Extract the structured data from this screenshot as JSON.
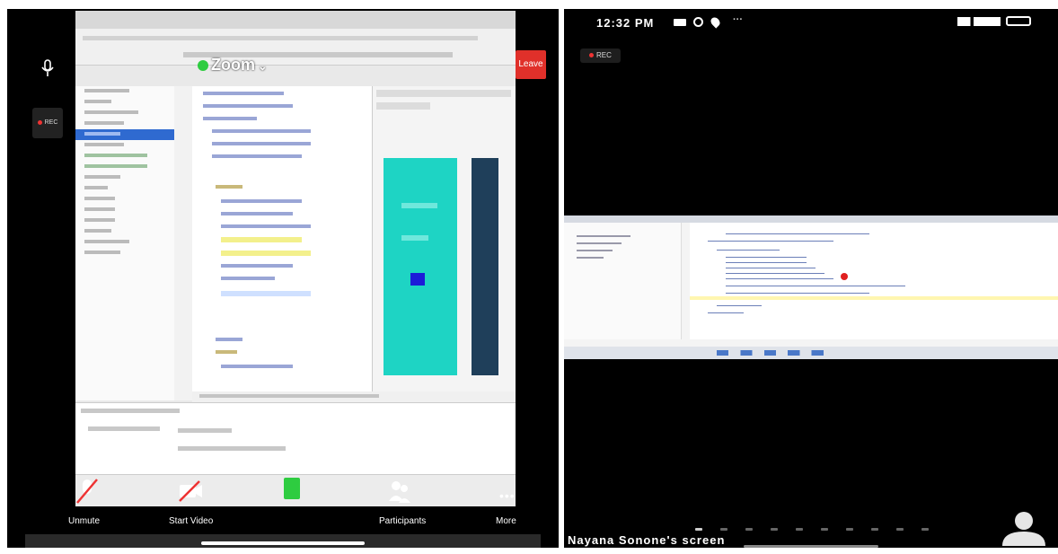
{
  "left": {
    "zoom_label": "Zoom",
    "leave_label": "Leave",
    "rec_label": "REC",
    "toolbar": {
      "unmute_label": "Unmute",
      "start_video_label": "Start Video",
      "participants_label": "Participants",
      "more_label": "More"
    }
  },
  "right": {
    "clock": "12:32 PM",
    "rec_label": "REC",
    "screen_label": "Nayana Sonone's screen"
  },
  "colors": {
    "leave_red": "#e0302a",
    "rec_red": "#e33333",
    "preview_teal": "#1ed4c4",
    "preview_button": "#1c1cd8",
    "tree_selection": "#2f6ad0",
    "editor_highlight": "#f3f08c"
  }
}
